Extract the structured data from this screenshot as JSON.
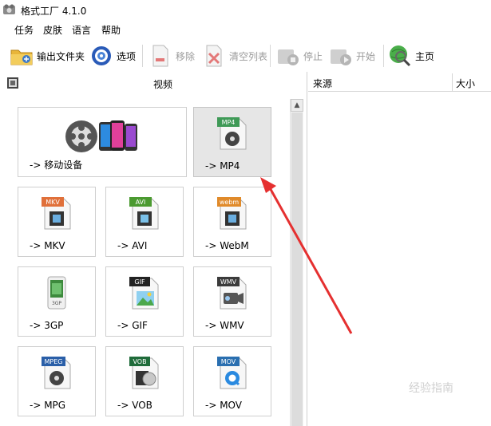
{
  "window": {
    "title": "格式工厂 4.1.0"
  },
  "menu": [
    "任务",
    "皮肤",
    "语言",
    "帮助"
  ],
  "toolbar": {
    "output_folder": "输出文件夹",
    "options": "选项",
    "remove": "移除",
    "clear_list": "清空列表",
    "stop": "停止",
    "start": "开始",
    "home": "主页"
  },
  "category": {
    "label": "视频"
  },
  "formats": [
    {
      "label": "-> 移动设备",
      "badge": ""
    },
    {
      "label": "-> MP4",
      "badge": "MP4",
      "badge_color": "#3f9a57"
    },
    {
      "label": "-> MKV",
      "badge": "MKV",
      "badge_color": "#e0703a"
    },
    {
      "label": "-> AVI",
      "badge": "AVI",
      "badge_color": "#4b9a30"
    },
    {
      "label": "-> WebM",
      "badge": "webm",
      "badge_color": "#e08a2a"
    },
    {
      "label": "-> 3GP",
      "badge": "3GP",
      "badge_color": "#3d8a3d"
    },
    {
      "label": "-> GIF",
      "badge": "GIF",
      "badge_color": "#222222"
    },
    {
      "label": "-> WMV",
      "badge": "WMV",
      "badge_color": "#3b3b3b"
    },
    {
      "label": "-> MPG",
      "badge": "MPEG",
      "badge_color": "#2a5fa8"
    },
    {
      "label": "-> VOB",
      "badge": "VOB",
      "badge_color": "#1f6b3a"
    },
    {
      "label": "-> MOV",
      "badge": "MOV",
      "badge_color": "#2a6fb0"
    }
  ],
  "list": {
    "columns": [
      "来源",
      "大小"
    ]
  },
  "watermark": "经验指南",
  "colors": {
    "arrow": "#e53030",
    "selected_tile": "#e6e6e6"
  }
}
